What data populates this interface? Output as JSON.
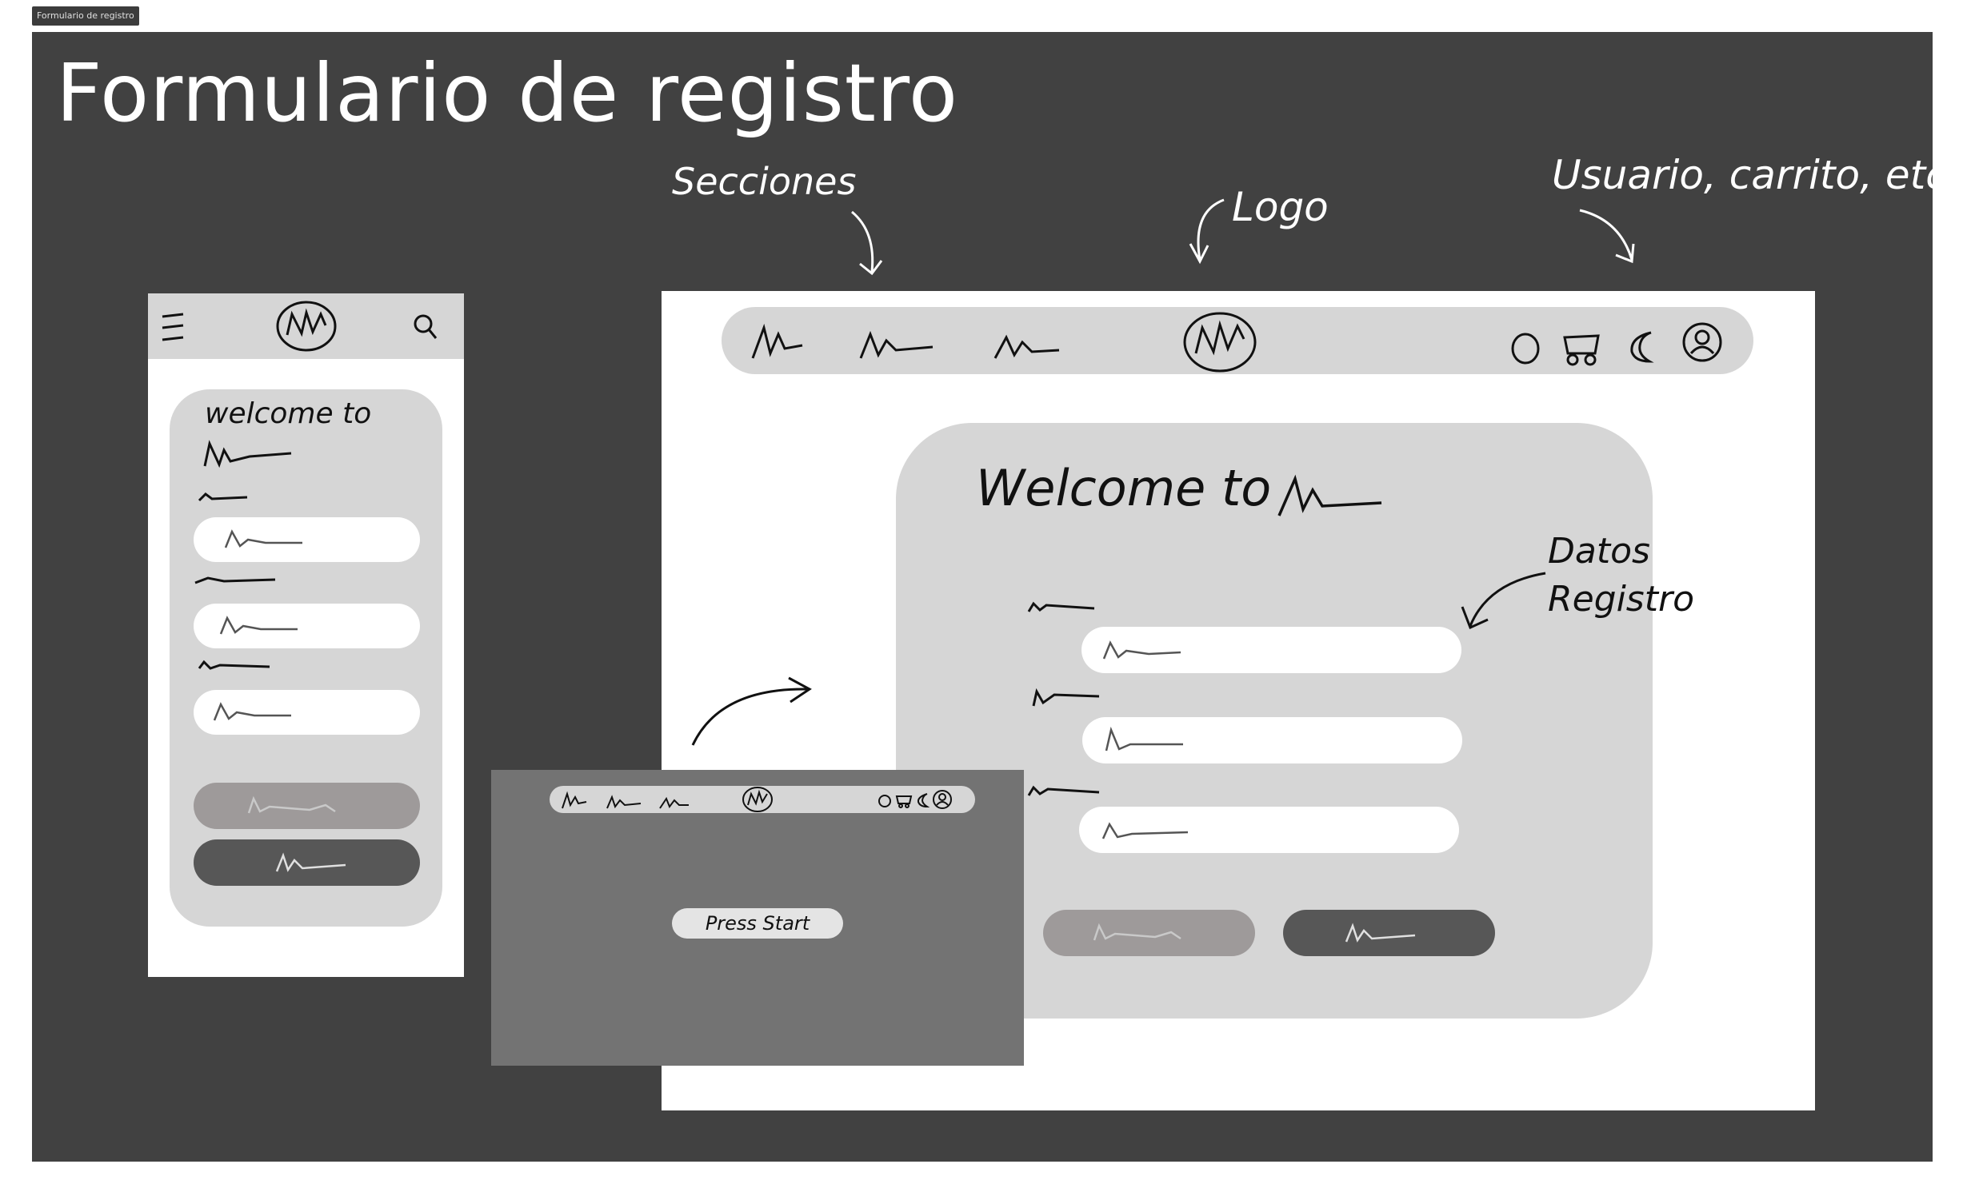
{
  "frame_tab": "Formulario de registro",
  "title": "Formulario de registro",
  "annotations": {
    "secciones": "Secciones",
    "logo": "Logo",
    "usuario": "Usuario, carrito, etc",
    "datos": "Datos",
    "registro": "Registro"
  },
  "mobile": {
    "welcome_line1": "welcome to"
  },
  "desktop": {
    "welcome": "Welcome to"
  },
  "splash": {
    "start_button": "Press Start"
  },
  "icons": [
    "menu-icon",
    "logo-icon",
    "search-icon",
    "circle-icon",
    "cart-icon",
    "moon-icon",
    "user-icon",
    "arrow-icon"
  ],
  "colors": {
    "board": "#414141",
    "panel": "#d6d6d6",
    "button_light": "#9e9a9a",
    "button_dark": "#575757",
    "splash": "#737373"
  }
}
